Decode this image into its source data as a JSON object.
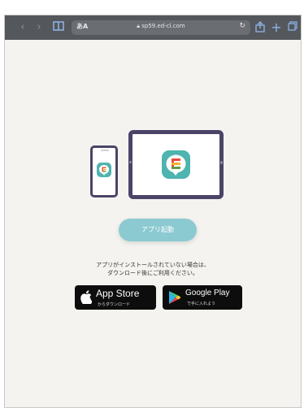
{
  "browser": {
    "url": "sp59.ed-cl.com",
    "aa_label": "あA"
  },
  "page": {
    "launch_button": "アプリ起動",
    "message_line1": "アプリがインストールされていない場合は、",
    "message_line2": "ダウンロード後にご利用ください。"
  },
  "stores": {
    "app_store_title": "App Store",
    "app_store_sub": "からダウンロード",
    "google_play_title": "Google Play",
    "google_play_sub": "で手に入れよう"
  },
  "colors": {
    "toolbar": "#54575c",
    "page_bg": "#f4f3ef",
    "device_frame": "#4b4467",
    "app_icon_bg": "#4fb3b0",
    "launch_button": "#8ccad2"
  },
  "icons": [
    "back-icon",
    "forward-icon",
    "book-icon",
    "lock-icon",
    "reload-icon",
    "share-icon",
    "plus-icon",
    "tabs-icon",
    "apple-icon",
    "google-play-icon",
    "app-icon"
  ]
}
